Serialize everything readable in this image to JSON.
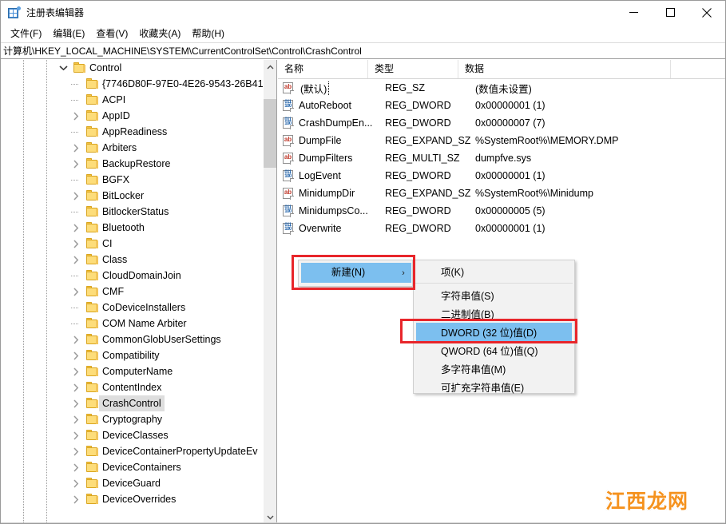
{
  "window": {
    "title": "注册表编辑器",
    "icon": "registry-icon",
    "controls": {
      "minimize": "minimize-icon",
      "maximize": "maximize-icon",
      "close": "close-icon"
    }
  },
  "menubar": {
    "items": [
      {
        "label": "文件(F)"
      },
      {
        "label": "编辑(E)"
      },
      {
        "label": "查看(V)"
      },
      {
        "label": "收藏夹(A)"
      },
      {
        "label": "帮助(H)"
      }
    ]
  },
  "address": {
    "path": "计算机\\HKEY_LOCAL_MACHINE\\SYSTEM\\CurrentControlSet\\Control\\CrashControl"
  },
  "tree": {
    "items": [
      {
        "label": "Control",
        "depth": 0,
        "twisty": "chevron-down",
        "expanded": true,
        "selected": false
      },
      {
        "label": "{7746D80F-97E0-4E26-9543-26B41",
        "depth": 1,
        "twisty": "none",
        "expanded": false,
        "selected": false
      },
      {
        "label": "ACPI",
        "depth": 1,
        "twisty": "none",
        "expanded": false,
        "selected": false
      },
      {
        "label": "AppID",
        "depth": 1,
        "twisty": "chevron-right",
        "expanded": false,
        "selected": false
      },
      {
        "label": "AppReadiness",
        "depth": 1,
        "twisty": "none",
        "expanded": false,
        "selected": false
      },
      {
        "label": "Arbiters",
        "depth": 1,
        "twisty": "chevron-right",
        "expanded": false,
        "selected": false
      },
      {
        "label": "BackupRestore",
        "depth": 1,
        "twisty": "chevron-right",
        "expanded": false,
        "selected": false
      },
      {
        "label": "BGFX",
        "depth": 1,
        "twisty": "none",
        "expanded": false,
        "selected": false
      },
      {
        "label": "BitLocker",
        "depth": 1,
        "twisty": "chevron-right",
        "expanded": false,
        "selected": false
      },
      {
        "label": "BitlockerStatus",
        "depth": 1,
        "twisty": "none",
        "expanded": false,
        "selected": false
      },
      {
        "label": "Bluetooth",
        "depth": 1,
        "twisty": "chevron-right",
        "expanded": false,
        "selected": false
      },
      {
        "label": "CI",
        "depth": 1,
        "twisty": "chevron-right",
        "expanded": false,
        "selected": false
      },
      {
        "label": "Class",
        "depth": 1,
        "twisty": "chevron-right",
        "expanded": false,
        "selected": false
      },
      {
        "label": "CloudDomainJoin",
        "depth": 1,
        "twisty": "none",
        "expanded": false,
        "selected": false
      },
      {
        "label": "CMF",
        "depth": 1,
        "twisty": "chevron-right",
        "expanded": false,
        "selected": false
      },
      {
        "label": "CoDeviceInstallers",
        "depth": 1,
        "twisty": "none",
        "expanded": false,
        "selected": false
      },
      {
        "label": "COM Name Arbiter",
        "depth": 1,
        "twisty": "none",
        "expanded": false,
        "selected": false
      },
      {
        "label": "CommonGlobUserSettings",
        "depth": 1,
        "twisty": "chevron-right",
        "expanded": false,
        "selected": false
      },
      {
        "label": "Compatibility",
        "depth": 1,
        "twisty": "chevron-right",
        "expanded": false,
        "selected": false
      },
      {
        "label": "ComputerName",
        "depth": 1,
        "twisty": "chevron-right",
        "expanded": false,
        "selected": false
      },
      {
        "label": "ContentIndex",
        "depth": 1,
        "twisty": "chevron-right",
        "expanded": false,
        "selected": false
      },
      {
        "label": "CrashControl",
        "depth": 1,
        "twisty": "chevron-right",
        "expanded": false,
        "selected": true
      },
      {
        "label": "Cryptography",
        "depth": 1,
        "twisty": "chevron-right",
        "expanded": false,
        "selected": false
      },
      {
        "label": "DeviceClasses",
        "depth": 1,
        "twisty": "chevron-right",
        "expanded": false,
        "selected": false
      },
      {
        "label": "DeviceContainerPropertyUpdateEv",
        "depth": 1,
        "twisty": "chevron-right",
        "expanded": false,
        "selected": false
      },
      {
        "label": "DeviceContainers",
        "depth": 1,
        "twisty": "chevron-right",
        "expanded": false,
        "selected": false
      },
      {
        "label": "DeviceGuard",
        "depth": 1,
        "twisty": "chevron-right",
        "expanded": false,
        "selected": false
      },
      {
        "label": "DeviceOverrides",
        "depth": 1,
        "twisty": "chevron-right",
        "expanded": false,
        "selected": false
      }
    ]
  },
  "values": {
    "columns": [
      {
        "label": "名称"
      },
      {
        "label": "类型"
      },
      {
        "label": "数据"
      }
    ],
    "rows": [
      {
        "icon": "string-value-icon",
        "name": "(默认)",
        "type": "REG_SZ",
        "data": "(数值未设置)",
        "focused": true
      },
      {
        "icon": "binary-value-icon",
        "name": "AutoReboot",
        "type": "REG_DWORD",
        "data": "0x00000001 (1)",
        "focused": false
      },
      {
        "icon": "binary-value-icon",
        "name": "CrashDumpEn...",
        "type": "REG_DWORD",
        "data": "0x00000007 (7)",
        "focused": false
      },
      {
        "icon": "string-value-icon",
        "name": "DumpFile",
        "type": "REG_EXPAND_SZ",
        "data": "%SystemRoot%\\MEMORY.DMP",
        "focused": false
      },
      {
        "icon": "string-value-icon",
        "name": "DumpFilters",
        "type": "REG_MULTI_SZ",
        "data": "dumpfve.sys",
        "focused": false
      },
      {
        "icon": "binary-value-icon",
        "name": "LogEvent",
        "type": "REG_DWORD",
        "data": "0x00000001 (1)",
        "focused": false
      },
      {
        "icon": "string-value-icon",
        "name": "MinidumpDir",
        "type": "REG_EXPAND_SZ",
        "data": "%SystemRoot%\\Minidump",
        "focused": false
      },
      {
        "icon": "binary-value-icon",
        "name": "MinidumpsCo...",
        "type": "REG_DWORD",
        "data": "0x00000005 (5)",
        "focused": false
      },
      {
        "icon": "binary-value-icon",
        "name": "Overwrite",
        "type": "REG_DWORD",
        "data": "0x00000001 (1)",
        "focused": false
      }
    ]
  },
  "context_menu": {
    "parent": {
      "label": "新建(N)",
      "arrow": "›",
      "highlighted": true
    },
    "submenu": {
      "items": [
        {
          "label": "项(K)",
          "highlighted": false
        },
        {
          "separator": true
        },
        {
          "label": "字符串值(S)",
          "highlighted": false
        },
        {
          "label": "二进制值(B)",
          "highlighted": false
        },
        {
          "label": "DWORD (32 位)值(D)",
          "highlighted": true
        },
        {
          "label": "QWORD (64 位)值(Q)",
          "highlighted": false
        },
        {
          "label": "多字符串值(M)",
          "highlighted": false
        },
        {
          "label": "可扩充字符串值(E)",
          "highlighted": false
        }
      ]
    }
  },
  "annotations": {
    "boxes": [
      {
        "name": "new-menu-highlight",
        "color": "#e8262b"
      },
      {
        "name": "dword-item-highlight",
        "color": "#e8262b"
      }
    ]
  },
  "watermark": {
    "text": "江西龙网",
    "color": "#f5921e"
  },
  "colors": {
    "menu_highlight": "#7cbfef",
    "selection": "#dedede",
    "annotation_red": "#e8262b"
  }
}
